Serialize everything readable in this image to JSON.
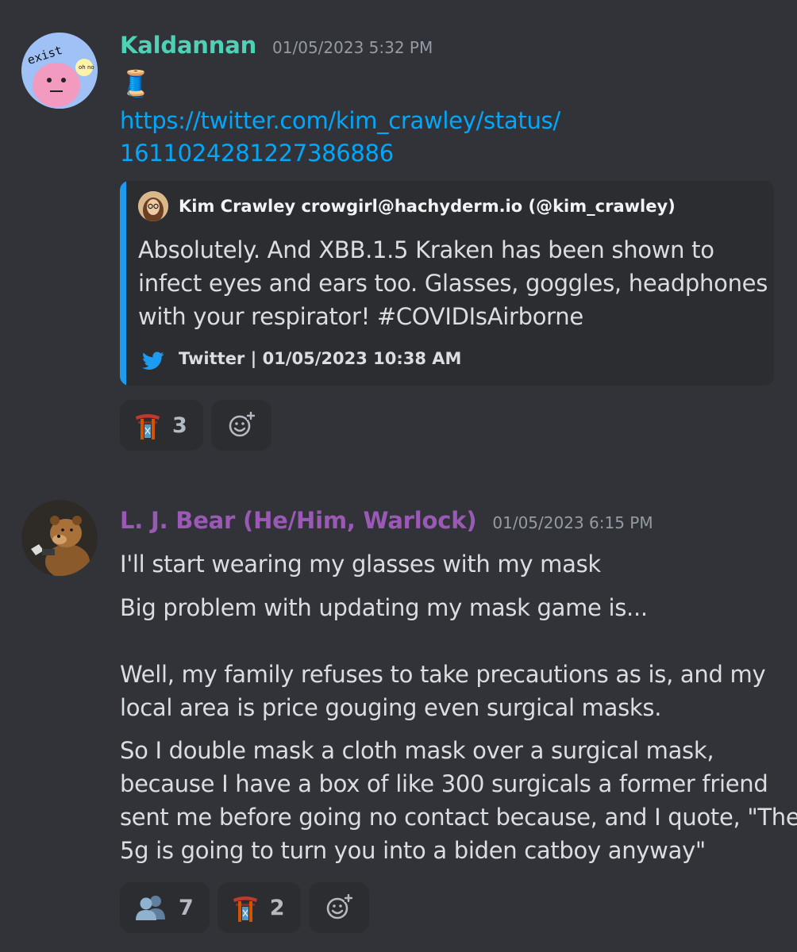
{
  "messages": [
    {
      "username": "Kaldannan",
      "username_color": "#4fd1b5",
      "timestamp": "01/05/2023 5:32 PM",
      "avatar_text": "exist",
      "avatar_text_small": "oh no",
      "emoji": "🧵",
      "link_lines": [
        "https://twitter.com/kim_crawley/status/",
        "1611024281227386886"
      ],
      "embed": {
        "author": "Kim Crawley crowgirl@hachyderm.io (@kim_crawley)",
        "description_lines": [
          "Absolutely. And XBB.1.5 Kraken has been shown to",
          "infect eyes and ears too. Glasses, goggles, headphones",
          "with your respirator! #COVIDIsAirborne"
        ],
        "footer": "Twitter | 01/05/2023 10:38 AM",
        "footer_icon": "twitter-bird-icon",
        "bar_color": "#1d9bf0"
      },
      "reactions": [
        {
          "emoji_name": "custom-torii-emoji",
          "count": "3"
        }
      ]
    },
    {
      "username": "L. J. Bear (He/Him, Warlock)",
      "username_color": "#9b59b6",
      "timestamp": "01/05/2023 6:15 PM",
      "lines": [
        "I'll start wearing my glasses with my mask",
        "Big problem with updating my mask game is...",
        "Well, my family refuses to take precautions as is, and my",
        "local area is price gouging even surgical masks.",
        "So I double mask a cloth mask over a surgical mask,",
        "because I have a box of like 300 surgicals a former friend",
        "sent me before going no contact because, and I quote, \"The",
        "5g is going to turn you into a biden catboy anyway\""
      ],
      "reactions": [
        {
          "emoji_name": "busts-in-silhouette-emoji",
          "count": "7"
        },
        {
          "emoji_name": "custom-torii-emoji",
          "count": "2"
        }
      ]
    }
  ],
  "add_reaction_icon": "add-reaction-icon"
}
